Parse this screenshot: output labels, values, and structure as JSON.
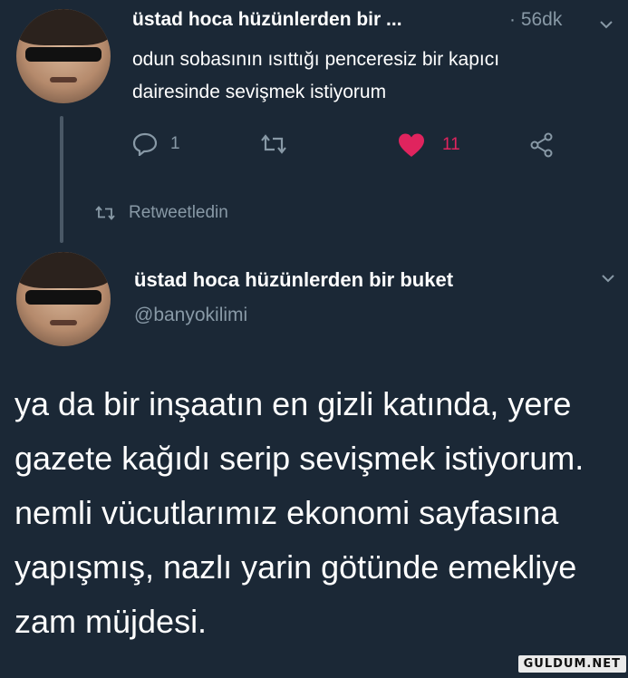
{
  "first_tweet": {
    "author_name": "üstad hoca hüzünlerden bir ...",
    "time": "· 56dk",
    "text": "odun sobasının ısıttığı penceresiz bir kapıcı dairesinde sevişmek istiyorum",
    "reply_count": "1",
    "retweet_count": "",
    "like_count": "11",
    "icons": [
      "reply-icon",
      "retweet-icon",
      "heart-icon",
      "share-icon",
      "chevron-down-icon"
    ]
  },
  "retweet_indicator": {
    "label": "Retweetledin"
  },
  "second_tweet": {
    "author_name": "üstad hoca hüzünlerden bir buket",
    "handle": "@banyokilimi",
    "text": "ya da bir inşaatın en gizli katında, yere gazete kağıdı serip sevişmek istiyorum. nemli vücutlarımız ekonomi sayfasına yapışmış, nazlı yarin götünde emekliye zam müjdesi."
  },
  "watermark": "GULDUM.NET",
  "colors": {
    "background": "#1b2836",
    "muted": "#8899a6",
    "like": "#e0245e",
    "text": "#ffffff"
  }
}
